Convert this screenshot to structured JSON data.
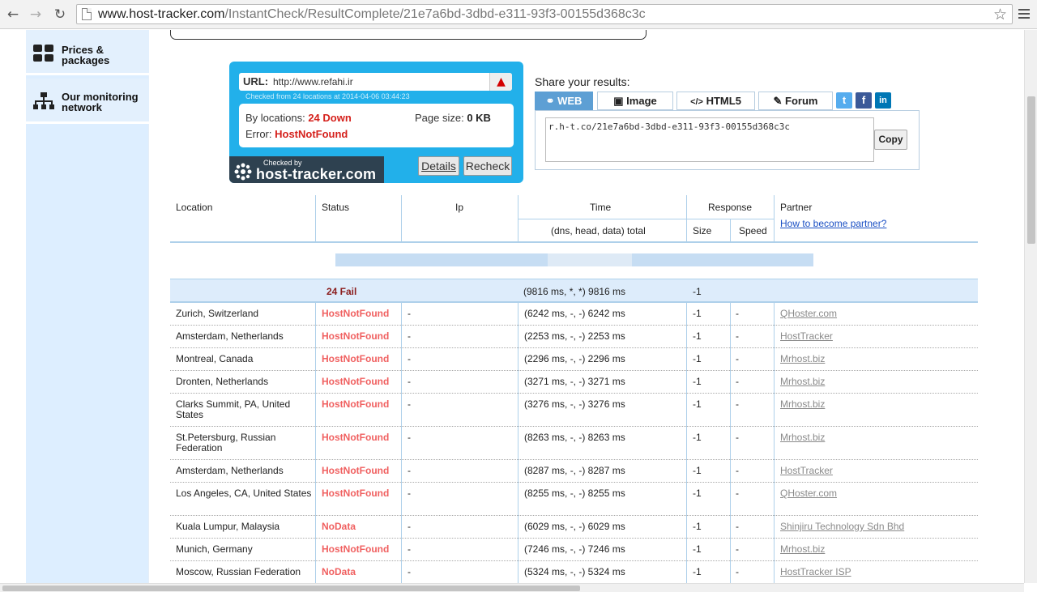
{
  "browser": {
    "url_host": "www.host-tracker.com",
    "url_path": "/InstantCheck/ResultComplete/21e7a6bd-3dbd-e311-93f3-00155d368c3c",
    "back_icon": "←",
    "forward_icon": "→",
    "reload_icon": "↻",
    "star_icon": "☆"
  },
  "sidebar": {
    "items": [
      {
        "label_line1": "Prices &",
        "label_line2": "packages",
        "icon": "grid-icon"
      },
      {
        "label_line1": "Our monitoring",
        "label_line2": "network",
        "icon": "network-icon"
      }
    ]
  },
  "widget": {
    "url_label": "URL:",
    "url_value": "http://www.refahi.ir",
    "warn_icon": "▲",
    "checked_from": "Checked from 24 locations at 2014-04-06 03:44:23",
    "by_locations_label": "By locations:",
    "by_locations_value": "24 Down",
    "error_label": "Error:",
    "error_value": "HostNotFound",
    "page_size_label": "Page size:",
    "page_size_value": "0 KB",
    "badge_small": "Checked by",
    "badge_big": "host-tracker.com",
    "details_label": "Details",
    "recheck_label": "Recheck"
  },
  "share": {
    "title": "Share your results:",
    "tabs": [
      {
        "label": "WEB",
        "icon": "link-icon",
        "glyph": "⚭"
      },
      {
        "label": "Image",
        "icon": "image-icon",
        "glyph": "▣"
      },
      {
        "label": "HTML5",
        "icon": "code-icon",
        "glyph": "</>"
      },
      {
        "label": "Forum",
        "icon": "edit-icon",
        "glyph": "✎"
      }
    ],
    "social": [
      {
        "name": "twitter",
        "glyph": "t",
        "color": "#55acee"
      },
      {
        "name": "facebook",
        "glyph": "f",
        "color": "#3b5998"
      },
      {
        "name": "linkedin",
        "glyph": "in",
        "color": "#0077b5"
      }
    ],
    "link_text": "r.h-t.co/21e7a6bd-3dbd-e311-93f3-00155d368c3c",
    "copy_label": "Copy"
  },
  "table": {
    "headers": {
      "location": "Location",
      "status": "Status",
      "ip": "Ip",
      "time": "Time",
      "time_sub": "(dns, head, data) total",
      "response": "Response",
      "size": "Size",
      "speed": "Speed",
      "partner": "Partner",
      "partner_link": "How to become partner?"
    },
    "summary": {
      "status": "24 Fail",
      "time": "(9816 ms, *, *) 9816 ms",
      "size": "-1"
    },
    "rows": [
      {
        "location": "Zurich, Switzerland",
        "status": "HostNotFound",
        "ip": "-",
        "time": "(6242 ms, -, -) 6242 ms",
        "size": "-1",
        "speed": "-",
        "partner": "QHoster.com"
      },
      {
        "location": "Amsterdam, Netherlands",
        "status": "HostNotFound",
        "ip": "-",
        "time": "(2253 ms, -, -) 2253 ms",
        "size": "-1",
        "speed": "-",
        "partner": "HostTracker"
      },
      {
        "location": "Montreal, Canada",
        "status": "HostNotFound",
        "ip": "-",
        "time": "(2296 ms, -, -) 2296 ms",
        "size": "-1",
        "speed": "-",
        "partner": "Mrhost.biz"
      },
      {
        "location": "Dronten, Netherlands",
        "status": "HostNotFound",
        "ip": "-",
        "time": "(3271 ms, -, -) 3271 ms",
        "size": "-1",
        "speed": "-",
        "partner": "Mrhost.biz"
      },
      {
        "location": "Clarks Summit, PA, United States",
        "status": "HostNotFound",
        "ip": "-",
        "time": "(3276 ms, -, -) 3276 ms",
        "size": "-1",
        "speed": "-",
        "partner": "Mrhost.biz"
      },
      {
        "location": "St.Petersburg, Russian Federation",
        "status": "HostNotFound",
        "ip": "-",
        "time": "(8263 ms, -, -) 8263 ms",
        "size": "-1",
        "speed": "-",
        "partner": "Mrhost.biz"
      },
      {
        "location": "Amsterdam, Netherlands",
        "status": "HostNotFound",
        "ip": "-",
        "time": "(8287 ms, -, -) 8287 ms",
        "size": "-1",
        "speed": "-",
        "partner": "HostTracker"
      },
      {
        "location": "Los Angeles, CA, United States",
        "status": "HostNotFound",
        "ip": "-",
        "time": "(8255 ms, -, -) 8255 ms",
        "size": "-1",
        "speed": "-",
        "partner": "QHoster.com"
      },
      {
        "location": "Kuala Lumpur, Malaysia",
        "status": "NoData",
        "ip": "-",
        "time": "(6029 ms, -, -) 6029 ms",
        "size": "-1",
        "speed": "-",
        "partner": "Shinjiru Technology Sdn Bhd"
      },
      {
        "location": "Munich, Germany",
        "status": "HostNotFound",
        "ip": "-",
        "time": "(7246 ms, -, -) 7246 ms",
        "size": "-1",
        "speed": "-",
        "partner": "Mrhost.biz"
      },
      {
        "location": "Moscow, Russian Federation",
        "status": "NoData",
        "ip": "-",
        "time": "(5324 ms, -, -) 5324 ms",
        "size": "-1",
        "speed": "-",
        "partner": "HostTracker ISP"
      }
    ]
  }
}
